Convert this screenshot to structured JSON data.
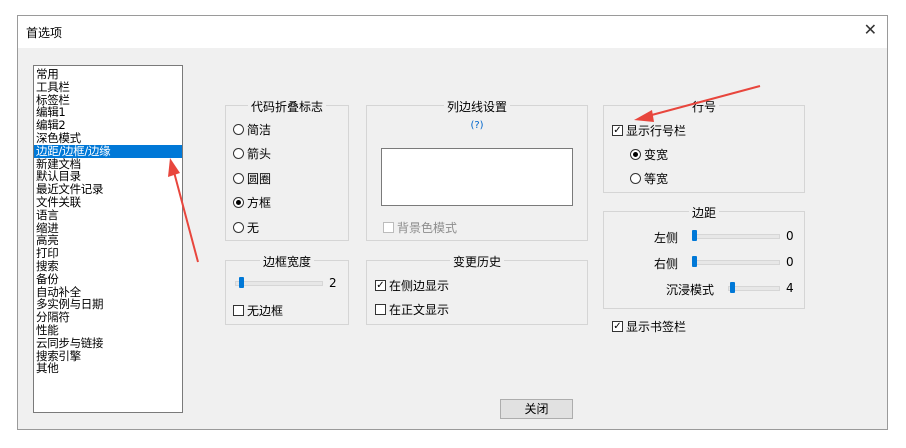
{
  "dialog": {
    "title": "首选项",
    "close_glyph": "✕"
  },
  "categories": [
    "常用",
    "工具栏",
    "标签栏",
    "编辑1",
    "编辑2",
    "深色模式",
    "边距/边框/边缘",
    "新建文档",
    "默认目录",
    "最近文件记录",
    "文件关联",
    "语言",
    "缩进",
    "高亮",
    "打印",
    "搜索",
    "备份",
    "自动补全",
    "多实例与日期",
    "分隔符",
    "性能",
    "云同步与链接",
    "搜索引擎",
    "其他"
  ],
  "selected_category": "边距/边框/边缘",
  "fold": {
    "label": "代码折叠标志",
    "options": [
      "简洁",
      "箭头",
      "圆圈",
      "方框",
      "无"
    ],
    "selected": "方框"
  },
  "border_width": {
    "label": "边框宽度",
    "value": "2",
    "no_border": "无边框"
  },
  "column_line": {
    "label": "列边线设置",
    "help": "(?)",
    "bg_mode": "背景色模式"
  },
  "change_history": {
    "label": "变更历史",
    "opt1": "在侧边显示",
    "opt2": "在正文显示"
  },
  "line_number": {
    "label": "行号",
    "show": "显示行号栏",
    "wide": "变宽",
    "fixed": "等宽"
  },
  "margin": {
    "label": "边距",
    "left_label": "左侧",
    "left_value": "0",
    "right_label": "右侧",
    "right_value": "0",
    "immersive_label": "沉浸模式",
    "immersive_value": "4"
  },
  "bookmark": {
    "label": "显示书签栏"
  },
  "buttons": {
    "close": "关闭"
  },
  "colors": {
    "accent": "#0078d7",
    "annotation_arrow": "#e8463d"
  }
}
